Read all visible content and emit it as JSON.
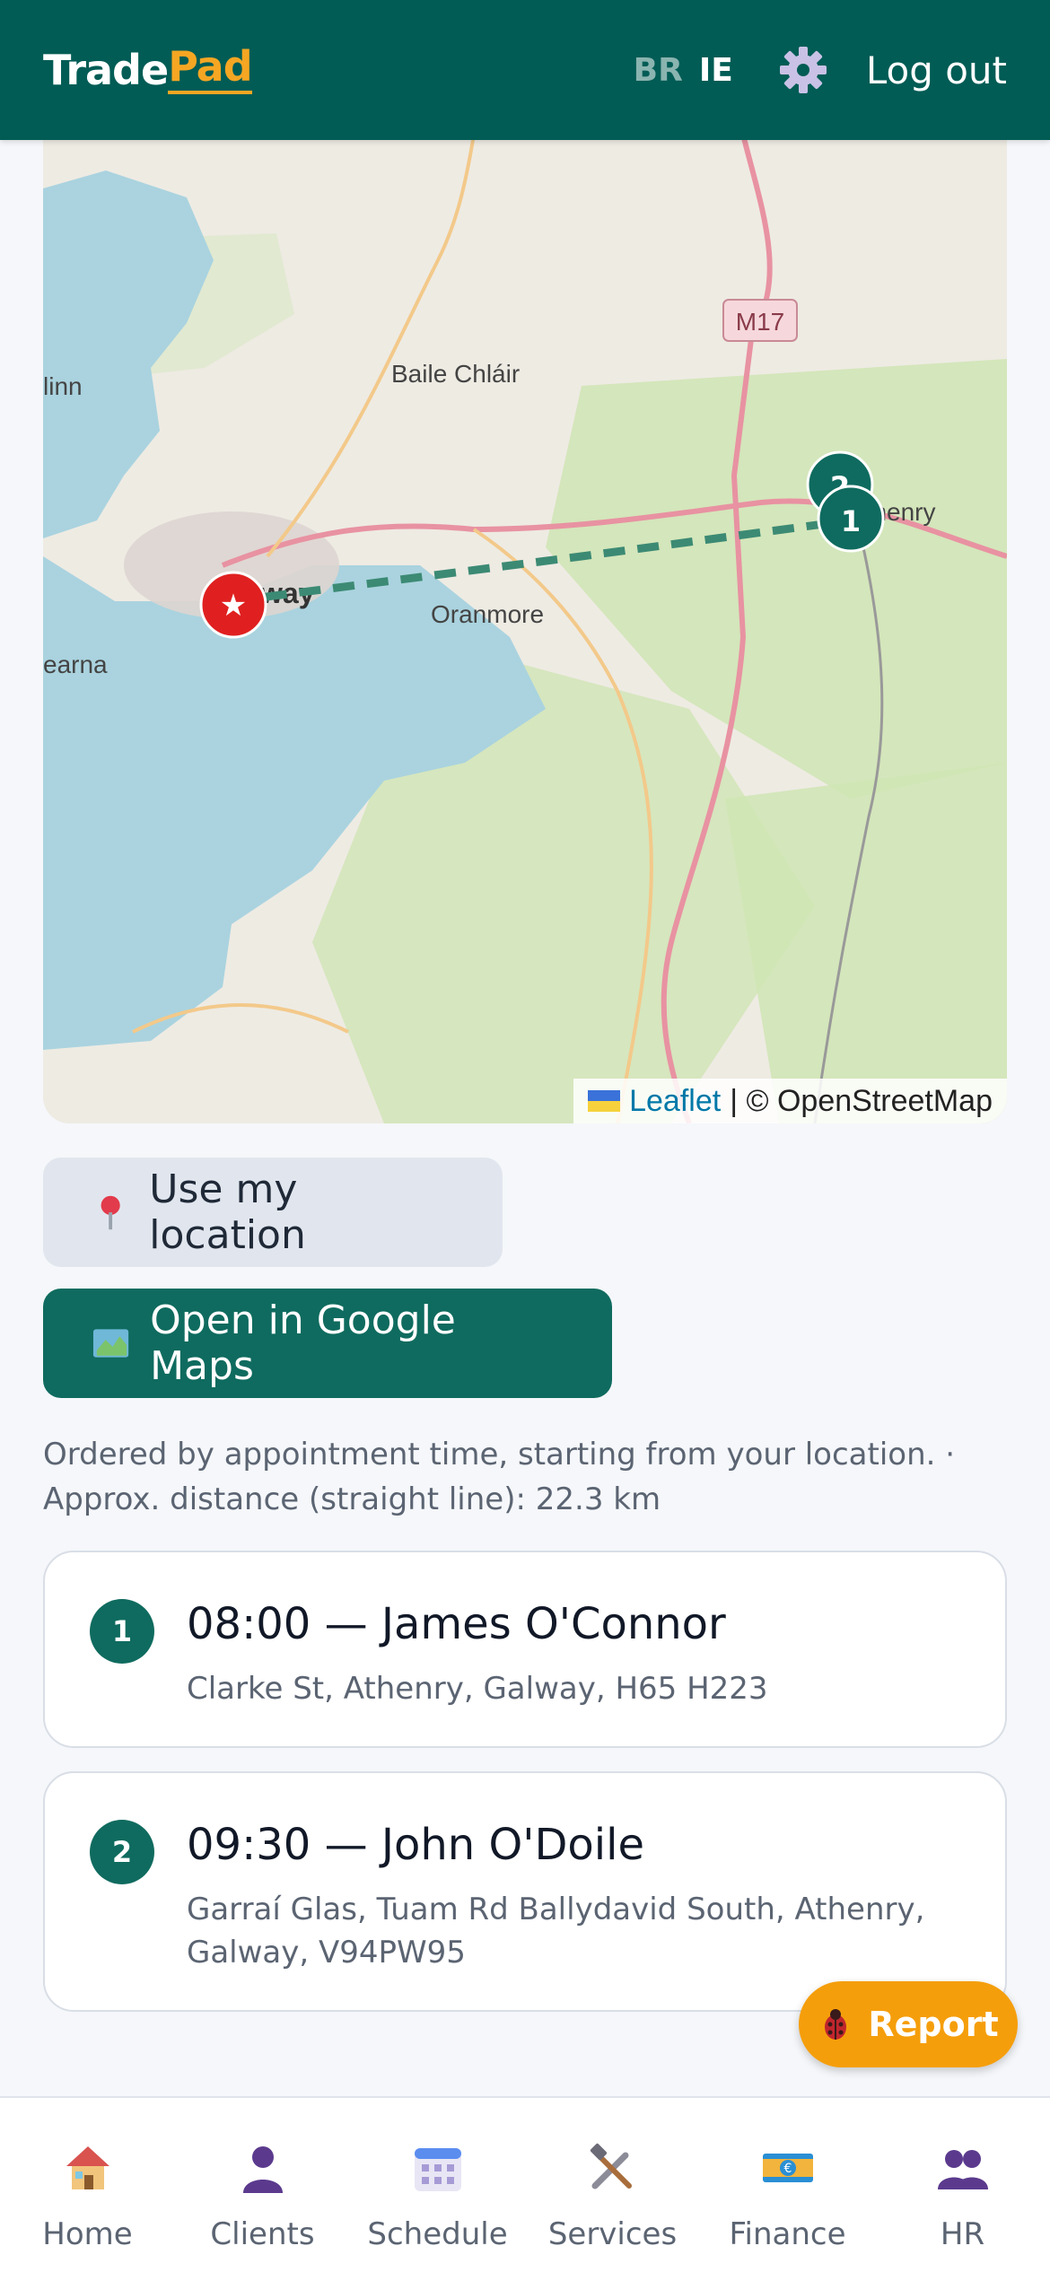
{
  "header": {
    "logo_part1": "Trade",
    "logo_part2": "Pad",
    "lang_br": "BR",
    "lang_ie": "IE",
    "logout": "Log out"
  },
  "map": {
    "labels": {
      "baile_chlair": "Baile Chláir",
      "oranmore": "Oranmore",
      "m17": "M17",
      "galway": "way",
      "athenry": "Athenry",
      "linn": "linn",
      "earna": "earna"
    },
    "markers": [
      {
        "label": "2"
      },
      {
        "label": "1"
      }
    ],
    "start_marker": "★",
    "attribution_leaflet": "Leaflet",
    "attribution_rest": "| © OpenStreetMap"
  },
  "actions": {
    "use_location": "Use my location",
    "open_maps": "Open in Google Maps"
  },
  "info": {
    "line1": "Ordered by appointment time, starting from your location. ·",
    "line2": "Approx. distance (straight line): 22.3 km"
  },
  "stops": [
    {
      "num": "1",
      "title": "08:00 — James O'Connor",
      "address": "Clarke St, Athenry, Galway, H65 H223"
    },
    {
      "num": "2",
      "title": "09:30 — John O'Doile",
      "address": "Garraí Glas, Tuam Rd Ballydavid South, Athenry, Galway, V94PW95"
    }
  ],
  "report": "Report",
  "nav": [
    {
      "label": "Home",
      "icon": "house-icon"
    },
    {
      "label": "Clients",
      "icon": "person-icon"
    },
    {
      "label": "Schedule",
      "icon": "calendar-icon"
    },
    {
      "label": "Services",
      "icon": "tools-icon"
    },
    {
      "label": "Finance",
      "icon": "banknote-icon"
    },
    {
      "label": "HR",
      "icon": "people-icon"
    }
  ],
  "colors": {
    "header": "#005c55",
    "accent": "#f5a623",
    "primary": "#0f6b5f",
    "report": "#f59e0b"
  }
}
